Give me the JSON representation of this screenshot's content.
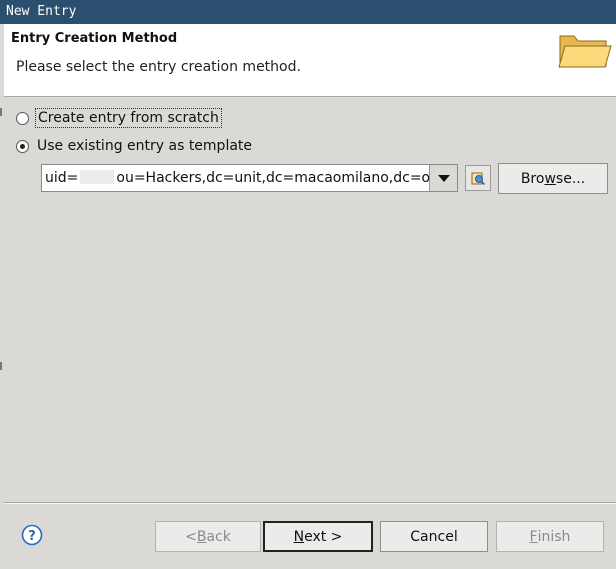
{
  "window": {
    "title": "New Entry"
  },
  "header": {
    "title": "Entry Creation Method",
    "description": "Please select the entry creation method."
  },
  "options": {
    "scratch": {
      "label": "Create entry from scratch",
      "selected": false
    },
    "template": {
      "label": "Use existing entry as template",
      "selected": true
    }
  },
  "template_entry": {
    "value_prefix": "uid=",
    "value_suffix": "ou=Hackers,dc=unit,dc=macaomilano,dc=org"
  },
  "buttons": {
    "browse": {
      "pre": "Bro",
      "ul": "w",
      "post": "se..."
    },
    "back": {
      "pre": "< ",
      "ul": "B",
      "post": "ack"
    },
    "next": {
      "pre": "",
      "ul": "N",
      "post": "ext >"
    },
    "cancel": "Cancel",
    "finish": {
      "pre": "",
      "ul": "F",
      "post": "inish"
    }
  },
  "icons": {
    "header": "folder-icon",
    "help": "help-icon",
    "dn_picker": "dn-picker-icon",
    "dropdown": "chevron-down-icon"
  }
}
